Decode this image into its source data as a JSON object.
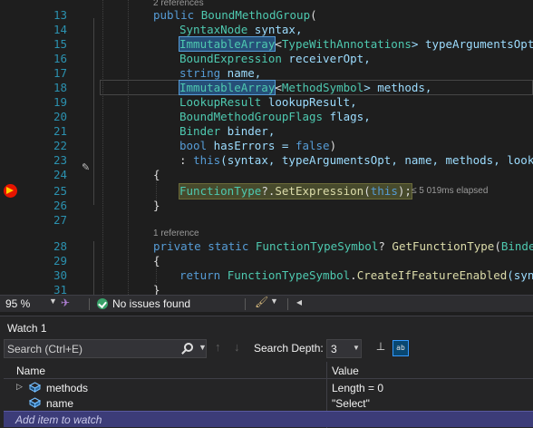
{
  "editor": {
    "codelens": [
      {
        "text": "2 references"
      },
      {
        "text": "1 reference"
      }
    ],
    "lines": {
      "l13": {
        "num": "13",
        "kw": "public ",
        "name": "BoundMethodGroup",
        "rest": "("
      },
      "l14": {
        "num": "14",
        "type": "SyntaxNode",
        "rest": " syntax,"
      },
      "l15": {
        "num": "15",
        "type": "ImmutableArray",
        "lt": "<",
        "type2": "TypeWithAnnotations",
        "rest": "> typeArgumentsOpt,"
      },
      "l16": {
        "num": "16",
        "type": "BoundExpression",
        "rest": " receiverOpt,"
      },
      "l17": {
        "num": "17",
        "kw": "string",
        "rest": " name,"
      },
      "l18": {
        "num": "18",
        "type": "ImmutableArray",
        "lt": "<",
        "type2": "MethodSymbol",
        "rest": "> methods,"
      },
      "l19": {
        "num": "19",
        "type": "LookupResult",
        "rest": " lookupResult,"
      },
      "l20": {
        "num": "20",
        "type": "BoundMethodGroupFlags",
        "rest": " flags,"
      },
      "l21": {
        "num": "21",
        "type": "Binder",
        "rest": " binder,"
      },
      "l22": {
        "num": "22",
        "kw": "bool",
        "rest": " hasErrors = ",
        "kw2": "false",
        "rest2": ")"
      },
      "l23": {
        "num": "23",
        "pre": ": ",
        "kw": "this",
        "rest": "(syntax, typeArgumentsOpt, name, methods, lookupR"
      },
      "l24": {
        "num": "24",
        "rest": "{"
      },
      "l25": {
        "num": "25",
        "type": "FunctionType",
        "rest": "?.",
        "method": "SetExpression",
        "rest2": "(",
        "kw": "this",
        "rest3": ");",
        "elapsed": "≤ 5 019ms elapsed"
      },
      "l26": {
        "num": "26",
        "rest": "}"
      },
      "l27": {
        "num": "27",
        "rest": ""
      },
      "l28": {
        "num": "28",
        "kw": "private static ",
        "type": "FunctionTypeSymbol",
        "rest": "? ",
        "method": "GetFunctionType",
        "rest2": "(",
        "type2": "Binder",
        "rest3": " "
      },
      "l29": {
        "num": "29",
        "rest": "{"
      },
      "l30": {
        "num": "30",
        "kw": "return ",
        "type": "FunctionTypeSymbol",
        "rest": ".",
        "method": "CreateIfFeatureEnabled",
        "rest2": "(synta"
      },
      "l31": {
        "num": "31",
        "rest": "}"
      }
    }
  },
  "status_bar": {
    "zoom": "95 %",
    "issues": "No issues found"
  },
  "watch": {
    "title": "Watch 1",
    "search_placeholder": "Search (Ctrl+E)",
    "depth_label": "Search Depth:",
    "depth_value": "3",
    "columns": {
      "name": "Name",
      "value": "Value"
    },
    "rows": [
      {
        "name": "methods",
        "value": "Length = 0",
        "expandable": true
      },
      {
        "name": "name",
        "value": "\"Select\"",
        "expandable": false
      }
    ],
    "add_item": "Add item to watch"
  },
  "colors": {
    "keyword": "#569cd6",
    "type": "#4ec9b0",
    "method": "#dcdcaa",
    "line_number": "#2b91af",
    "breakpoint": "#e51400",
    "current_statement": "#474a2c"
  }
}
